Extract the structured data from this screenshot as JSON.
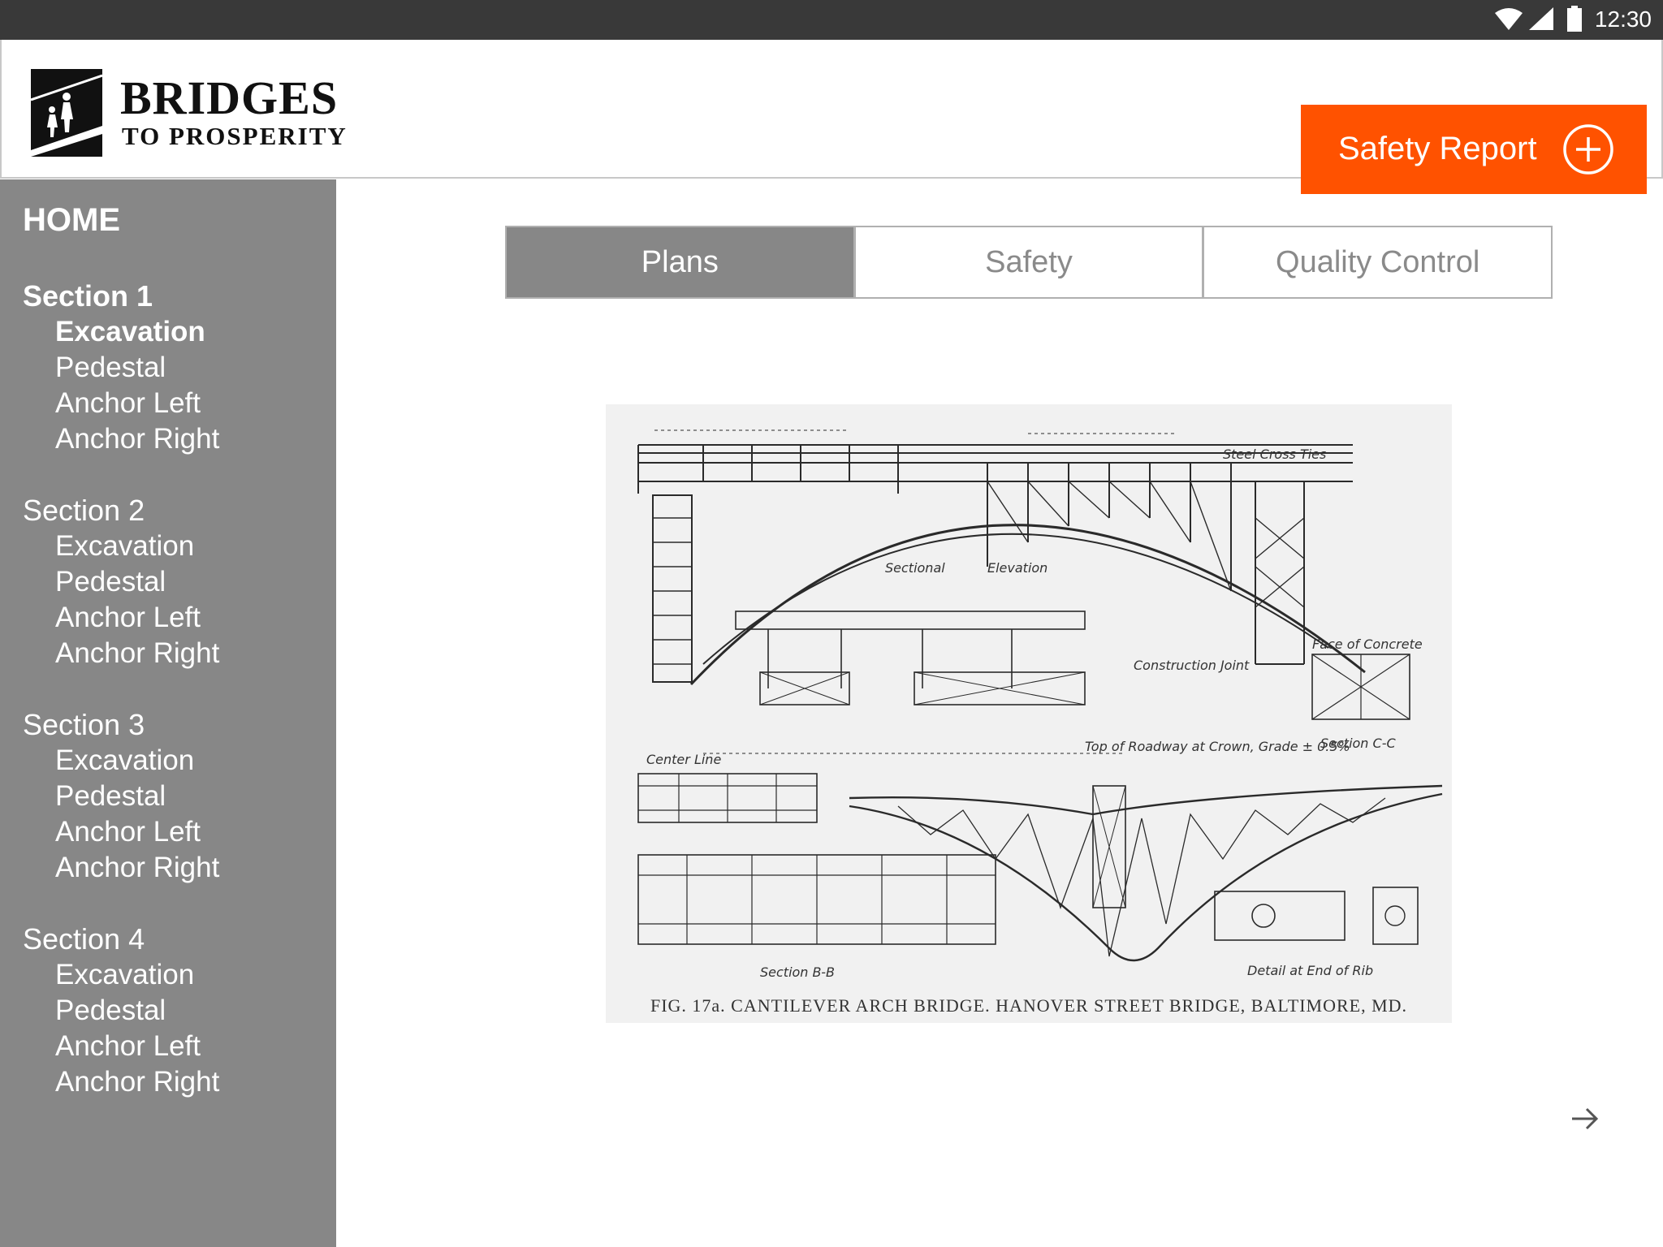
{
  "status_bar": {
    "time": "12:30"
  },
  "brand": {
    "title": "BRIDGES",
    "subtitle": "TO PROSPERITY"
  },
  "header": {
    "safety_report_label": "Safety Report"
  },
  "sidebar": {
    "home_label": "HOME",
    "sections": [
      {
        "title": "Section 1",
        "active": true,
        "items": [
          "Excavation",
          "Pedestal",
          "Anchor Left",
          "Anchor Right"
        ],
        "active_item": "Excavation"
      },
      {
        "title": "Section 2",
        "active": false,
        "items": [
          "Excavation",
          "Pedestal",
          "Anchor Left",
          "Anchor Right"
        ]
      },
      {
        "title": "Section 3",
        "active": false,
        "items": [
          "Excavation",
          "Pedestal",
          "Anchor Left",
          "Anchor Right"
        ]
      },
      {
        "title": "Section 4",
        "active": false,
        "items": [
          "Excavation",
          "Pedestal",
          "Anchor Left",
          "Anchor Right"
        ]
      }
    ]
  },
  "tabs": [
    {
      "label": "Plans",
      "active": true
    },
    {
      "label": "Safety",
      "active": false
    },
    {
      "label": "Quality Control",
      "active": false
    }
  ],
  "plan_image": {
    "caption": "FIG. 17a. CANTILEVER ARCH BRIDGE. HANOVER STREET BRIDGE, BALTIMORE, MD.",
    "labels": {
      "sectional": "Sectional",
      "elevation": "Elevation",
      "section_bb": "Section B-B",
      "section_cc": "Section C-C",
      "detail_end_rib": "Detail at End of Rib",
      "center_line": "Center Line",
      "steel_cross_ties": "Steel Cross Ties",
      "face_of_concrete": "Face of Concrete",
      "construction_joint": "Construction Joint",
      "top_of_roadway": "Top of Roadway at Crown, Grade ± 0.5%"
    }
  },
  "colors": {
    "accent": "#ff5200",
    "sidebar": "#878787",
    "status_bar": "#393939",
    "tab_active": "#878787",
    "tab_inactive_text": "#8a8a8a"
  },
  "icons": {
    "plus": "plus-circle-icon",
    "next": "arrow-right-icon",
    "wifi": "wifi-icon",
    "signal": "signal-icon",
    "battery": "battery-icon"
  }
}
